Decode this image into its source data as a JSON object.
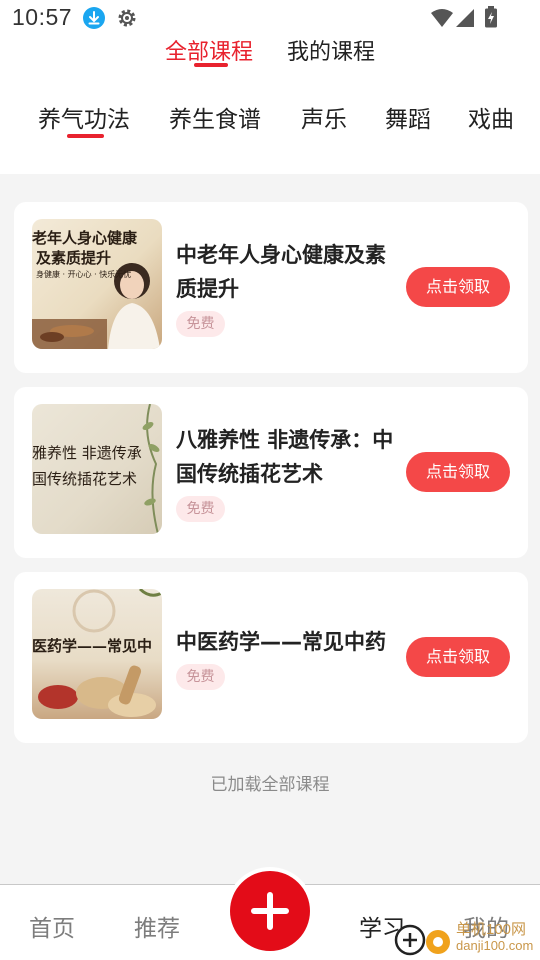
{
  "status_bar": {
    "time": "10:57"
  },
  "top_tabs": [
    {
      "label": "全部课程",
      "active": true
    },
    {
      "label": "我的课程",
      "active": false
    }
  ],
  "category_tabs": [
    {
      "label": "养气功法",
      "active": true
    },
    {
      "label": "养生食谱",
      "active": false
    },
    {
      "label": "声乐",
      "active": false
    },
    {
      "label": "舞蹈",
      "active": false
    },
    {
      "label": "戏曲",
      "active": false
    }
  ],
  "courses": [
    {
      "title": "中老年人身心健康及素质提升",
      "badge": "免费",
      "button": "点击领取",
      "thumb_lines": [
        "老年人身心健康",
        "及素质提升",
        "身健康 · 开心心 · 快乐无忧"
      ]
    },
    {
      "title": "八雅养性 非遗传承：中国传统插花艺术",
      "badge": "免费",
      "button": "点击领取",
      "thumb_lines": [
        "雅养性  非遗传承",
        "国传统插花艺术"
      ]
    },
    {
      "title": "中医药学——常见中药",
      "badge": "免费",
      "button": "点击领取",
      "thumb_lines": [
        "医药学——常见中"
      ]
    }
  ],
  "footer_note": "已加载全部课程",
  "bottom_nav": [
    {
      "label": "首页",
      "active": false
    },
    {
      "label": "推荐",
      "active": false
    },
    {
      "label": "学习",
      "active": true
    },
    {
      "label": "我的",
      "active": false
    }
  ],
  "watermark": {
    "text": "单机100网",
    "url": "danji100.com"
  },
  "colors": {
    "accent": "#e8222e",
    "button": "#f44848",
    "fab": "#e30c18",
    "badge_bg": "#fde9ea"
  }
}
